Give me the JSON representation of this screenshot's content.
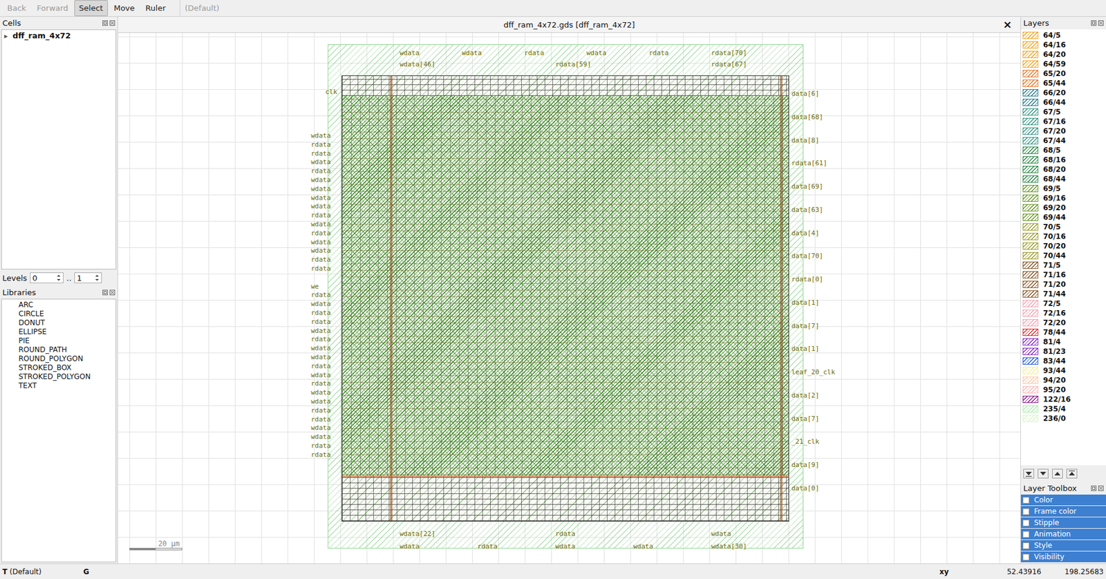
{
  "toolbar": [
    {
      "label": "Back",
      "disabled": true,
      "selected": false
    },
    {
      "label": "Forward",
      "disabled": true,
      "selected": false
    },
    {
      "label": "Select",
      "disabled": false,
      "selected": true
    },
    {
      "label": "Move",
      "disabled": false,
      "selected": false
    },
    {
      "label": "Ruler",
      "disabled": false,
      "selected": false
    },
    {
      "label": "(Default)",
      "disabled": true,
      "selected": false
    }
  ],
  "cells": {
    "title": "Cells",
    "items": [
      {
        "label": "dff_ram_4x72",
        "toggle": "▸",
        "expanded": false
      }
    ]
  },
  "levels": {
    "label": "Levels",
    "from": "0",
    "sep": "..",
    "to": "1"
  },
  "libraries": {
    "title": "Libraries",
    "items": [
      "ARC",
      "CIRCLE",
      "DONUT",
      "ELLIPSE",
      "PIE",
      "ROUND_PATH",
      "ROUND_POLYGON",
      "STROKED_BOX",
      "STROKED_POLYGON",
      "TEXT"
    ]
  },
  "view": {
    "title": "dff_ram_4x72.gds [dff_ram_4x72]",
    "close": "×",
    "scale": "20 µm",
    "clk": "clk",
    "left_pins": [
      "wdata",
      "rdata",
      "rdata",
      "wdata",
      "rdata",
      "wdata",
      "wdata",
      "wdata",
      "wdata",
      "rdata",
      "wdata",
      "rdata",
      "wdata",
      "wdata",
      "rdata",
      "rdata",
      "we",
      "rdata",
      "wdata",
      "rdata",
      "rdata",
      "wdata",
      "rdata",
      "wdata",
      "wdata",
      "rdata",
      "wdata",
      "rdata",
      "wdata",
      "wdata",
      "rdata",
      "rdata",
      "wdata",
      "wdata",
      "rdata",
      "rdata"
    ],
    "right_pins": [
      "data[6]",
      "data[68]",
      "data[8]",
      "rdata[61]",
      "data[69]",
      "data[63]",
      "data[4]",
      "data[70]",
      "rdata[0]",
      "data[1]",
      "data[7]",
      "data[1]",
      "leaf_20_clk",
      "data[2]",
      "data[7]",
      "_21_clk",
      "data[9]",
      "data[0]"
    ],
    "top_pins": [
      [
        "wdata",
        "wdata",
        "rdata",
        "wdata",
        "rdata",
        "rdata[70]"
      ],
      [
        "wdata[46]",
        "rdata[59]",
        "rdata[67]"
      ]
    ],
    "bottom_pins": [
      [
        "wdata[22]",
        "rdata",
        "wdata"
      ],
      [
        "wdata",
        "rdata",
        "wdata",
        "wdata",
        "wdata[30]"
      ]
    ]
  },
  "layers": {
    "title": "Layers",
    "items": [
      {
        "name": "64/5",
        "color": "#f5a623"
      },
      {
        "name": "64/16",
        "color": "#f5a623"
      },
      {
        "name": "64/20",
        "color": "#f5a623"
      },
      {
        "name": "64/59",
        "color": "#f5a623"
      },
      {
        "name": "65/20",
        "color": "#e8782a"
      },
      {
        "name": "65/44",
        "color": "#e8782a"
      },
      {
        "name": "66/20",
        "color": "#2a7f8f"
      },
      {
        "name": "66/44",
        "color": "#2a7f8f"
      },
      {
        "name": "67/5",
        "color": "#3a9a88"
      },
      {
        "name": "67/16",
        "color": "#3a9a88"
      },
      {
        "name": "67/20",
        "color": "#3a9a88"
      },
      {
        "name": "67/44",
        "color": "#3a9a88"
      },
      {
        "name": "68/5",
        "color": "#2e8b4a"
      },
      {
        "name": "68/16",
        "color": "#2e8b4a"
      },
      {
        "name": "68/20",
        "color": "#2e8b4a"
      },
      {
        "name": "68/44",
        "color": "#2e8b4a"
      },
      {
        "name": "69/5",
        "color": "#6b9a2a"
      },
      {
        "name": "69/16",
        "color": "#6b9a2a"
      },
      {
        "name": "69/20",
        "color": "#6b9a2a"
      },
      {
        "name": "69/44",
        "color": "#6b9a2a"
      },
      {
        "name": "70/5",
        "color": "#a0a030"
      },
      {
        "name": "70/16",
        "color": "#a0a030"
      },
      {
        "name": "70/20",
        "color": "#a0a030"
      },
      {
        "name": "70/44",
        "color": "#a0a030"
      },
      {
        "name": "71/5",
        "color": "#8b5a2b"
      },
      {
        "name": "71/16",
        "color": "#8b5a2b"
      },
      {
        "name": "71/20",
        "color": "#8b5a2b"
      },
      {
        "name": "71/44",
        "color": "#8b5a2b"
      },
      {
        "name": "72/5",
        "color": "#f4a6b4"
      },
      {
        "name": "72/16",
        "color": "#f4a6b4"
      },
      {
        "name": "72/20",
        "color": "#f4a6b4"
      },
      {
        "name": "78/44",
        "color": "#e03030"
      },
      {
        "name": "81/4",
        "color": "#8a30c8"
      },
      {
        "name": "81/23",
        "color": "#8a30c8"
      },
      {
        "name": "83/44",
        "color": "#2a60e0"
      },
      {
        "name": "93/44",
        "color": "#f5f0a0"
      },
      {
        "name": "94/20",
        "color": "#ffc8a8"
      },
      {
        "name": "95/20",
        "color": "#ffb8b8"
      },
      {
        "name": "122/16",
        "color": "#902090"
      },
      {
        "name": "235/4",
        "color": "#b0ecb0"
      },
      {
        "name": "236/0",
        "color": "#d8f8c8"
      }
    ]
  },
  "layer_toolbox": {
    "title": "Layer Toolbox",
    "items": [
      "Color",
      "Frame color",
      "Stipple",
      "Animation",
      "Style",
      "Visibility"
    ]
  },
  "status": {
    "tool": "T",
    "mode": "(Default)",
    "grid": "G",
    "coord_label": "xy",
    "x": "52.43916",
    "y": "198.25683"
  }
}
